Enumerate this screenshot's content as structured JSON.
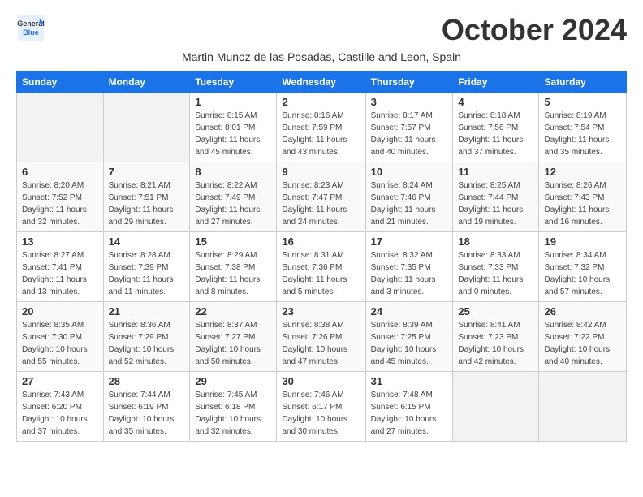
{
  "logo": {
    "general": "General",
    "blue": "Blue"
  },
  "title": "October 2024",
  "subtitle": "Martin Munoz de las Posadas, Castille and Leon, Spain",
  "days_header": [
    "Sunday",
    "Monday",
    "Tuesday",
    "Wednesday",
    "Thursday",
    "Friday",
    "Saturday"
  ],
  "weeks": [
    [
      {
        "num": "",
        "info": ""
      },
      {
        "num": "",
        "info": ""
      },
      {
        "num": "1",
        "info": "Sunrise: 8:15 AM\nSunset: 8:01 PM\nDaylight: 11 hours and 45 minutes."
      },
      {
        "num": "2",
        "info": "Sunrise: 8:16 AM\nSunset: 7:59 PM\nDaylight: 11 hours and 43 minutes."
      },
      {
        "num": "3",
        "info": "Sunrise: 8:17 AM\nSunset: 7:57 PM\nDaylight: 11 hours and 40 minutes."
      },
      {
        "num": "4",
        "info": "Sunrise: 8:18 AM\nSunset: 7:56 PM\nDaylight: 11 hours and 37 minutes."
      },
      {
        "num": "5",
        "info": "Sunrise: 8:19 AM\nSunset: 7:54 PM\nDaylight: 11 hours and 35 minutes."
      }
    ],
    [
      {
        "num": "6",
        "info": "Sunrise: 8:20 AM\nSunset: 7:52 PM\nDaylight: 11 hours and 32 minutes."
      },
      {
        "num": "7",
        "info": "Sunrise: 8:21 AM\nSunset: 7:51 PM\nDaylight: 11 hours and 29 minutes."
      },
      {
        "num": "8",
        "info": "Sunrise: 8:22 AM\nSunset: 7:49 PM\nDaylight: 11 hours and 27 minutes."
      },
      {
        "num": "9",
        "info": "Sunrise: 8:23 AM\nSunset: 7:47 PM\nDaylight: 11 hours and 24 minutes."
      },
      {
        "num": "10",
        "info": "Sunrise: 8:24 AM\nSunset: 7:46 PM\nDaylight: 11 hours and 21 minutes."
      },
      {
        "num": "11",
        "info": "Sunrise: 8:25 AM\nSunset: 7:44 PM\nDaylight: 11 hours and 19 minutes."
      },
      {
        "num": "12",
        "info": "Sunrise: 8:26 AM\nSunset: 7:43 PM\nDaylight: 11 hours and 16 minutes."
      }
    ],
    [
      {
        "num": "13",
        "info": "Sunrise: 8:27 AM\nSunset: 7:41 PM\nDaylight: 11 hours and 13 minutes."
      },
      {
        "num": "14",
        "info": "Sunrise: 8:28 AM\nSunset: 7:39 PM\nDaylight: 11 hours and 11 minutes."
      },
      {
        "num": "15",
        "info": "Sunrise: 8:29 AM\nSunset: 7:38 PM\nDaylight: 11 hours and 8 minutes."
      },
      {
        "num": "16",
        "info": "Sunrise: 8:31 AM\nSunset: 7:36 PM\nDaylight: 11 hours and 5 minutes."
      },
      {
        "num": "17",
        "info": "Sunrise: 8:32 AM\nSunset: 7:35 PM\nDaylight: 11 hours and 3 minutes."
      },
      {
        "num": "18",
        "info": "Sunrise: 8:33 AM\nSunset: 7:33 PM\nDaylight: 11 hours and 0 minutes."
      },
      {
        "num": "19",
        "info": "Sunrise: 8:34 AM\nSunset: 7:32 PM\nDaylight: 10 hours and 57 minutes."
      }
    ],
    [
      {
        "num": "20",
        "info": "Sunrise: 8:35 AM\nSunset: 7:30 PM\nDaylight: 10 hours and 55 minutes."
      },
      {
        "num": "21",
        "info": "Sunrise: 8:36 AM\nSunset: 7:29 PM\nDaylight: 10 hours and 52 minutes."
      },
      {
        "num": "22",
        "info": "Sunrise: 8:37 AM\nSunset: 7:27 PM\nDaylight: 10 hours and 50 minutes."
      },
      {
        "num": "23",
        "info": "Sunrise: 8:38 AM\nSunset: 7:26 PM\nDaylight: 10 hours and 47 minutes."
      },
      {
        "num": "24",
        "info": "Sunrise: 8:39 AM\nSunset: 7:25 PM\nDaylight: 10 hours and 45 minutes."
      },
      {
        "num": "25",
        "info": "Sunrise: 8:41 AM\nSunset: 7:23 PM\nDaylight: 10 hours and 42 minutes."
      },
      {
        "num": "26",
        "info": "Sunrise: 8:42 AM\nSunset: 7:22 PM\nDaylight: 10 hours and 40 minutes."
      }
    ],
    [
      {
        "num": "27",
        "info": "Sunrise: 7:43 AM\nSunset: 6:20 PM\nDaylight: 10 hours and 37 minutes."
      },
      {
        "num": "28",
        "info": "Sunrise: 7:44 AM\nSunset: 6:19 PM\nDaylight: 10 hours and 35 minutes."
      },
      {
        "num": "29",
        "info": "Sunrise: 7:45 AM\nSunset: 6:18 PM\nDaylight: 10 hours and 32 minutes."
      },
      {
        "num": "30",
        "info": "Sunrise: 7:46 AM\nSunset: 6:17 PM\nDaylight: 10 hours and 30 minutes."
      },
      {
        "num": "31",
        "info": "Sunrise: 7:48 AM\nSunset: 6:15 PM\nDaylight: 10 hours and 27 minutes."
      },
      {
        "num": "",
        "info": ""
      },
      {
        "num": "",
        "info": ""
      }
    ]
  ]
}
